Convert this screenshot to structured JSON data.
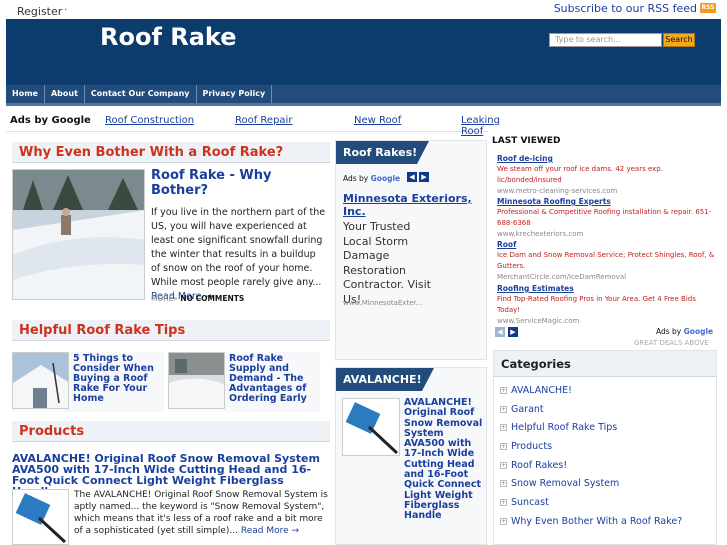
{
  "topbar": {
    "register": "Register",
    "dot": "·",
    "rss": "Subscribe to our RSS feed",
    "rss_icon": "RSS"
  },
  "site": {
    "title": "Roof Rake"
  },
  "search": {
    "placeholder": "Type to search...",
    "button": "Search"
  },
  "nav": [
    "Home",
    "About",
    "Contact Our Company",
    "Privacy Policy"
  ],
  "adlinks": {
    "label": "Ads by Google",
    "links": [
      "Roof Construction",
      "Roof Repair",
      "New Roof",
      "Leaking Roof"
    ]
  },
  "post1": {
    "section": "Why Even Bother With a Roof Rake?",
    "title": "Roof Rake - Why Bother?",
    "text": "If you live in the northern part of the US, you will have experienced at least one significant snowfall during the winter that results in a buildup of snow on the roof of your home. While most people rarely give any...",
    "read_more": "Read More →",
    "more_label": "MORE»",
    "comments": "NO COMMENTS"
  },
  "tips": {
    "section": "Helpful Roof Rake Tips",
    "items": [
      "5 Things to Consider When Buying a Roof Rake For Your Home",
      "Roof Rake Supply and Demand - The Advantages of Ordering Early"
    ]
  },
  "products": {
    "section": "Products",
    "title": "AVALANCHE! Original Roof Snow Removal System AVA500 with 17-Inch Wide Cutting Head and 16-Foot Quick Connect Light Weight Fiberglass Handle",
    "text": "The AVALANCHE! Original Roof Snow Removal System is aptly named... the keyword is \"Snow Removal System\", which means that it's less of a roof rake and a bit more of a sophisticated (yet still simple)...",
    "read_more": "Read More →"
  },
  "widget1": {
    "title": "Roof Rakes!",
    "ads_label": "Ads by",
    "google": "Google",
    "ad_title": "Minnesota Exteriors, Inc.",
    "ad_text": "Your Trusted Local Storm Damage Restoration Contractor. Visit Us!",
    "ad_url": "www.MinnesotaExter..."
  },
  "widget2": {
    "title": "AVALANCHE!",
    "text": "AVALANCHE! Original Roof Snow Removal System AVA500 with 17-Inch Wide Cutting Head and 16-Foot Quick Connect Light Weight Fiberglass Handle"
  },
  "lastviewed": {
    "title": "LAST VIEWED",
    "items": [
      {
        "t": "Roof de-icing",
        "d": "We steam off your roof ice dams. 42 years exp. lic/bonded/insured",
        "u": "www.metro-cleaning-services.com"
      },
      {
        "t": "Minnesota Roofing Experts",
        "d": "Professional & Competitive Roofing installation & repair. 651-688-6368",
        "u": "www.krechexteriors.com"
      },
      {
        "t": "Roof",
        "d": "Ice Dam and Snow Removal Service; Protect Shingles, Roof, & Gutters.",
        "u": "MerchantCircle.com/IceDamRemoval"
      },
      {
        "t": "Roofing Estimates",
        "d": "Find Top-Rated Roofing Pros in Your Area. Get 4 Free Bids Today!",
        "u": "www.ServiceMagic.com"
      }
    ],
    "ads_label": "Ads by",
    "google": "Google",
    "deals": "GREAT DEALS ABOVE"
  },
  "categories": {
    "title": "Categories",
    "items": [
      "AVALANCHE!",
      "Garant",
      "Helpful Roof Rake Tips",
      "Products",
      "Roof Rakes!",
      "Snow Removal System",
      "Suncast",
      "Why Even Bother With a Roof Rake?"
    ]
  },
  "colors": {
    "header": "#0c3c6d",
    "nav": "#214c7b",
    "accent": "#d0311d",
    "link": "#1a3f9c",
    "search_button": "#f4a81d"
  }
}
